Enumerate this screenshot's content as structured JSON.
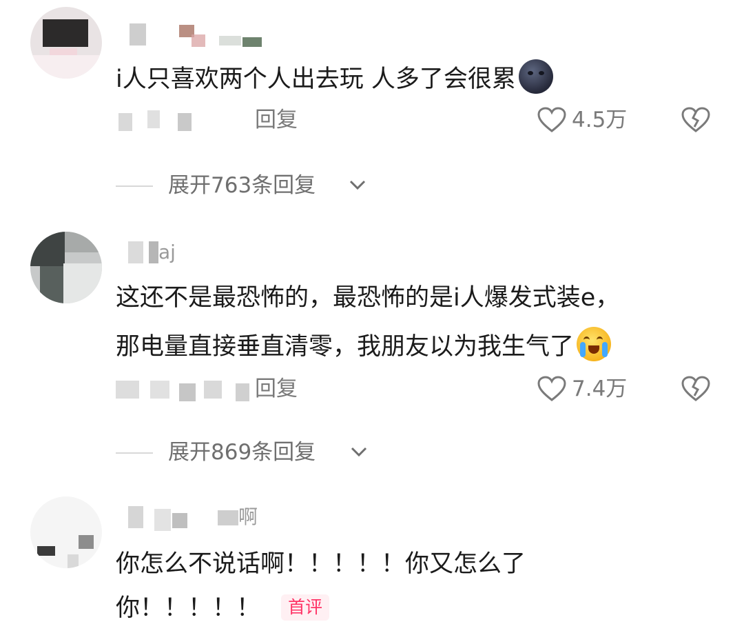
{
  "comments": [
    {
      "username_suffix": "",
      "text_lines": [
        "i人只喜欢两个人出去玩  人多了会很累"
      ],
      "emoji": "new-moon-face-icon",
      "reply_label": "回复",
      "likes": "4.5万",
      "expand_label": "展开763条回复"
    },
    {
      "username_suffix": "aj",
      "text_lines": [
        "这还不是最恐怖的，最恐怖的是i人爆发式装e，",
        "那电量直接垂直清零，我朋友以为我生气了"
      ],
      "emoji": "loudly-crying-face-icon",
      "reply_label": "回复",
      "likes": "7.4万",
      "expand_label": "展开869条回复"
    },
    {
      "username_suffix": "啊",
      "text_lines": [
        "你怎么不说话啊！！！！！你又怎么了",
        "你！！！！！"
      ],
      "badge": "首评"
    }
  ],
  "colors": {
    "text": "#1b1b1b",
    "meta": "#7a7a7a",
    "badge": "#ff3366"
  }
}
